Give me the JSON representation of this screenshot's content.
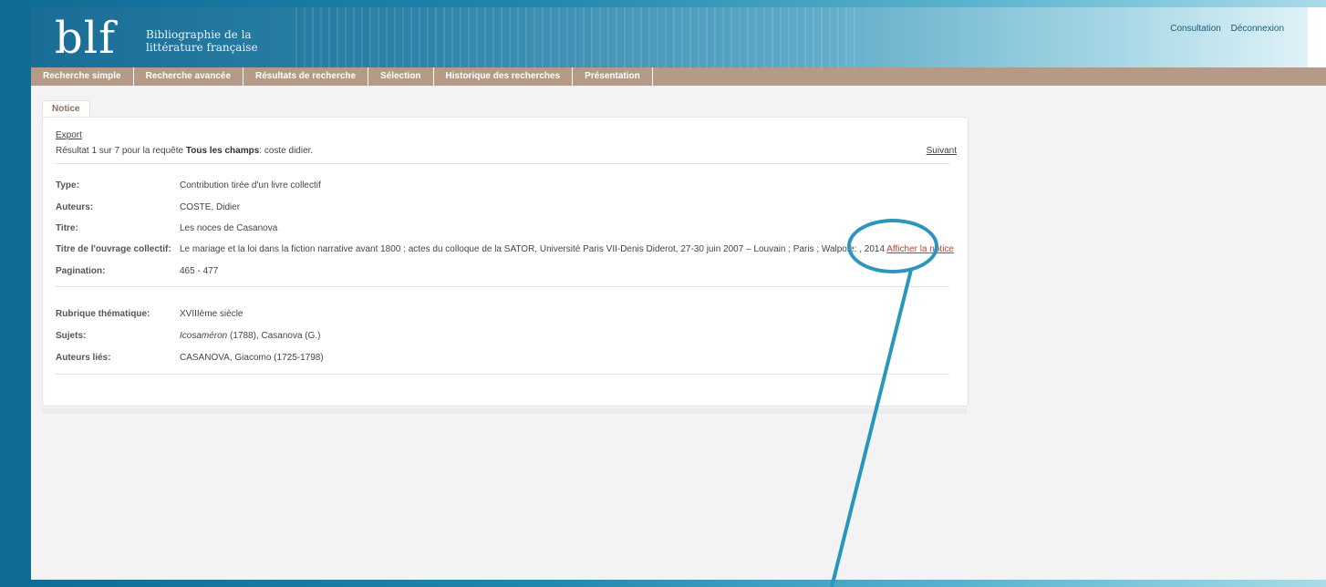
{
  "header": {
    "logo": "blf",
    "logo_line1": "Bibliographie de la",
    "logo_line2": "littérature française",
    "link_consultation": "Consultation",
    "link_deconnexion": "Déconnexion"
  },
  "nav": [
    {
      "label": "Recherche simple"
    },
    {
      "label": "Recherche avancée"
    },
    {
      "label": "Résultats de recherche"
    },
    {
      "label": "Sélection"
    },
    {
      "label": "Historique des recherches"
    },
    {
      "label": "Présentation"
    }
  ],
  "tab_label": "Notice",
  "notice": {
    "export_label": "Export",
    "result_prefix": "Résultat 1 sur 7 pour la requête",
    "result_field": "Tous les champs",
    "result_query": ": coste didier.",
    "next_label": "Suivant",
    "fields": [
      {
        "label": "Type:",
        "value": "Contribution tirée d'un livre collectif"
      },
      {
        "label": "Auteurs:",
        "value": "COSTE, Didier"
      },
      {
        "label": "Titre:",
        "value": "Les noces de Casanova"
      },
      {
        "label": "Titre de l'ouvrage collectif:",
        "value": "Le mariage et la loi dans la fiction narrative avant 1800 : actes du colloque de la SATOR, Université Paris VII-Denis Diderot, 27-30 juin 2007 – Louvain ; Paris ; Walpole: , 2014",
        "link": "Afficher la notice"
      },
      {
        "label": "Pagination:",
        "value": "465 - 477"
      }
    ],
    "fields2": [
      {
        "label": "Rubrique thématique:",
        "value": "XVIIIème siècle"
      },
      {
        "label": "Sujets:",
        "value_italic": "Icosaméron",
        "value": " (1788), Casanova (G.)"
      },
      {
        "label": "Auteurs liés:",
        "value": "CASANOVA, Giacomo (1725-1798)"
      }
    ]
  },
  "colors": {
    "nav_bg": "#b49a87",
    "link_red": "#c4422a",
    "highlight_blue": "#2a95bd"
  }
}
